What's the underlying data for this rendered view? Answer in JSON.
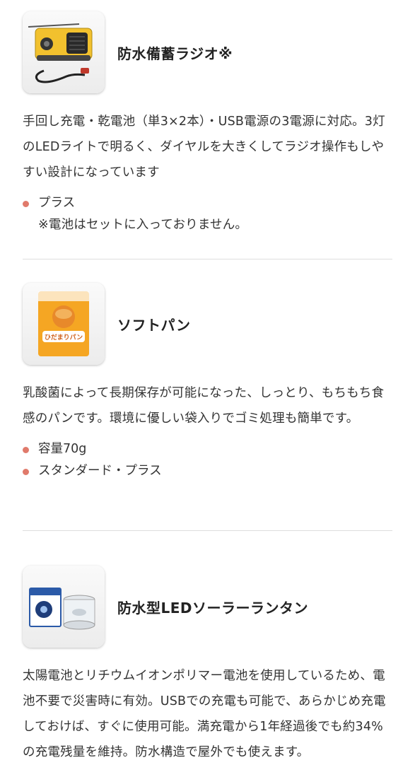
{
  "products": [
    {
      "title": "防水備蓄ラジオ※",
      "icon": "radio-image",
      "description": "手回し充電・乾電池（単3×2本）・USB電源の3電源に対応。3灯のLEDライトで明るく、ダイヤルを大きくしてラジオ操作もしやすい設計になっています",
      "bullets": [
        "プラス"
      ],
      "note": "※電池はセットに入っておりません。"
    },
    {
      "title": "ソフトパン",
      "icon": "bread-package-image",
      "package_text": "ひだまりパン",
      "description": "乳酸菌によって長期保存が可能になった、しっとり、もちもち食感のパンです。環境に優しい袋入りでゴミ処理も簡単です。",
      "bullets": [
        "容量70g",
        "スタンダード・プラス"
      ]
    },
    {
      "title": "防水型LEDソーラーランタン",
      "icon": "lantern-image",
      "description": "太陽電池とリチウムイオンポリマー電池を使用しているため、電池不要で災害時に有効。USBでの充電も可能で、あらかじめ充電しておけば、すぐに使用可能。満充電から1年経過後でも約34%の充電残量を維持。防水構造で屋外でも使えます。"
    }
  ],
  "colors": {
    "bullet": "#e07a6b",
    "separator": "#dddddd",
    "text": "#333333"
  }
}
